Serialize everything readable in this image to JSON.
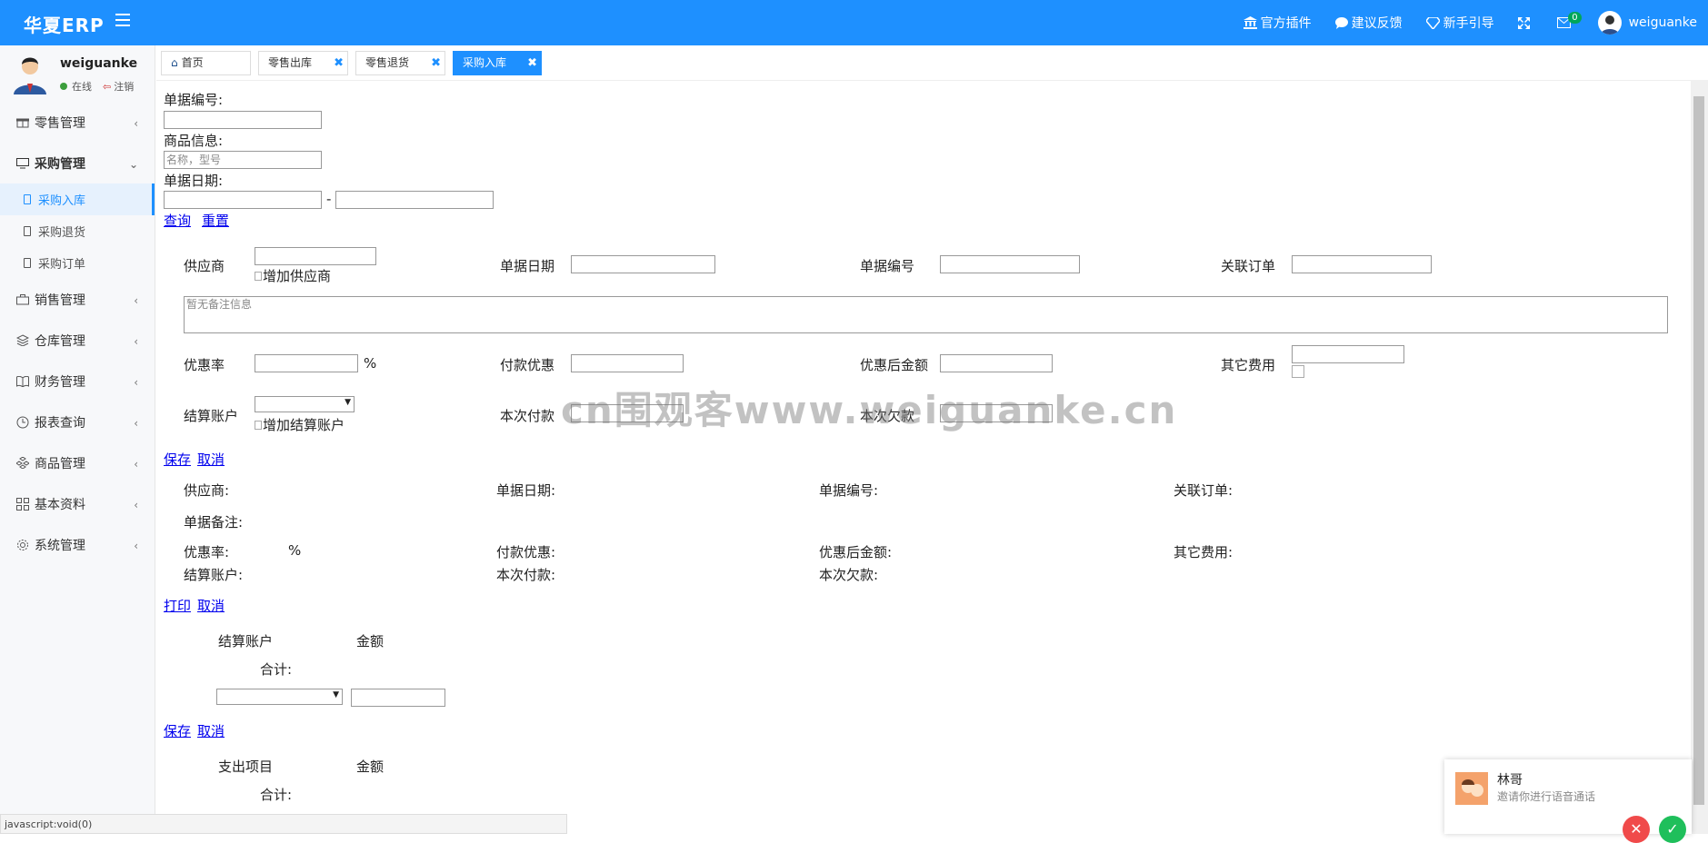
{
  "app": {
    "brand": "华夏ERP",
    "user": "weiguanke"
  },
  "topnav": {
    "plugins": "官方插件",
    "feedback": "建议反馈",
    "guide": "新手引导",
    "mail_badge": "0"
  },
  "sidebar": {
    "username": "weiguanke",
    "status": "在线",
    "logout": "注销",
    "menu": [
      "零售管理",
      "采购管理",
      "销售管理",
      "仓库管理",
      "财务管理",
      "报表查询",
      "商品管理",
      "基本资料",
      "系统管理"
    ],
    "sub": [
      "采购入库",
      "采购退货",
      "采购订单"
    ]
  },
  "tabs": [
    "首页",
    "零售出库",
    "零售退货",
    "采购入库"
  ],
  "search": {
    "bill_no_label": "单据编号:",
    "product_label": "商品信息:",
    "product_placeholder": "名称，型号",
    "date_label": "单据日期:",
    "dash": "-",
    "query": "查询",
    "reset": "重置"
  },
  "form": {
    "supplier": "供应商",
    "add_supplier": "增加供应商",
    "bill_date": "单据日期",
    "bill_no": "单据编号",
    "related_order": "关联订单",
    "remark_placeholder": "暂无备注信息",
    "discount_rate": "优惠率",
    "percent": "%",
    "pay_discount": "付款优惠",
    "after_discount": "优惠后金额",
    "other_fee": "其它费用",
    "account": "结算账户",
    "add_account": "增加结算账户",
    "this_pay": "本次付款",
    "this_debt": "本次欠款",
    "save": "保存",
    "cancel": "取消"
  },
  "detail": {
    "supplier": "供应商:",
    "bill_date": "单据日期:",
    "bill_no": "单据编号:",
    "related_order": "关联订单:",
    "remark": "单据备注:",
    "discount_rate": "优惠率:",
    "percent": "%",
    "pay_discount": "付款优惠:",
    "after_discount": "优惠后金额:",
    "other_fee": "其它费用:",
    "account": "结算账户:",
    "this_pay": "本次付款:",
    "this_debt": "本次欠款:",
    "print": "打印",
    "cancel": "取消"
  },
  "accounts": {
    "col_account": "结算账户",
    "col_amount": "金额",
    "total": "合计:",
    "save": "保存",
    "cancel": "取消"
  },
  "expenses": {
    "col_item": "支出项目",
    "col_amount": "金额",
    "total": "合计:"
  },
  "watermark": "cn围观客www.weiguanke.cn",
  "statusbar": "javascript:void(0)",
  "notification": {
    "name": "林哥",
    "msg": "邀请你进行语音通话"
  }
}
